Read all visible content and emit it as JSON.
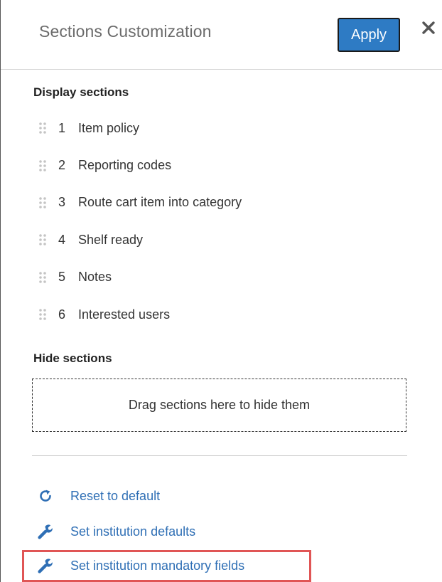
{
  "header": {
    "title": "Sections Customization",
    "apply_label": "Apply",
    "close_glyph": "✕"
  },
  "display": {
    "heading": "Display sections",
    "items": [
      {
        "num": "1",
        "label": "Item policy"
      },
      {
        "num": "2",
        "label": "Reporting codes"
      },
      {
        "num": "3",
        "label": "Route cart item into category"
      },
      {
        "num": "4",
        "label": "Shelf ready"
      },
      {
        "num": "5",
        "label": "Notes"
      },
      {
        "num": "6",
        "label": "Interested users"
      }
    ]
  },
  "hide": {
    "heading": "Hide sections",
    "drop_text": "Drag sections here to hide them"
  },
  "actions": {
    "reset_label": "Reset to default",
    "reset_icon": "refresh-icon",
    "defaults_label": "Set institution defaults",
    "defaults_icon": "wrench-icon",
    "mandatory_label": "Set institution mandatory fields",
    "mandatory_icon": "wrench-icon"
  },
  "colors": {
    "accent": "#2e7bc4",
    "link": "#2f6fb5",
    "highlight": "#e05555"
  }
}
